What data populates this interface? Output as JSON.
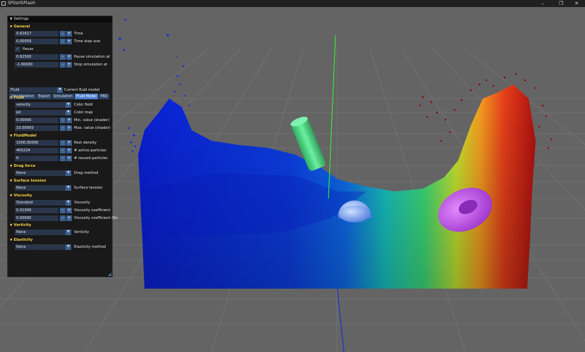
{
  "window": {
    "title": "SPlisHSPlasH",
    "minimize_glyph": "–",
    "maximize_glyph": "❐",
    "close_glyph": "✕"
  },
  "panel": {
    "title": "Settings",
    "collapse_glyph": "▼",
    "general": {
      "header": "General",
      "time": {
        "value": "0.62617",
        "label": "Time"
      },
      "time_step": {
        "value": "0.00059",
        "label": "Time step size"
      },
      "pause": {
        "label": "Pause",
        "checked": true,
        "check_glyph": "✓"
      },
      "pause_at": {
        "value": "0.62500",
        "label": "Pause simulation at"
      },
      "stop_at": {
        "value": "-1.00000",
        "label": "Stop simulation at"
      }
    },
    "tabs": [
      "Visualization",
      "Export",
      "Simulation",
      "Fluid Model",
      "PBD"
    ],
    "active_tab": "Fluid Model",
    "current_fluid": {
      "value": "Fluid",
      "label": "Current fluid model"
    },
    "fluid": {
      "header": "Fluid",
      "color_field": {
        "value": "velocity",
        "label": "Color field"
      },
      "color_map": {
        "value": "Jet",
        "label": "Color map"
      },
      "min_value": {
        "value": "0.00000",
        "label": "Min. value (shader)"
      },
      "max_value": {
        "value": "10.00000",
        "label": "Max. value (shader)"
      }
    },
    "fluid_model": {
      "header": "FluidModel",
      "rest_density": {
        "value": "1000.00000",
        "label": "Rest density"
      },
      "active_particles": {
        "value": "405224",
        "label": "# active particles"
      },
      "reused_particles": {
        "value": "0",
        "label": "# reused particles"
      }
    },
    "drag": {
      "header": "Drag force",
      "value": "None",
      "label": "Drag method"
    },
    "surface_tension": {
      "header": "Surface tension",
      "value": "None",
      "label": "Surface tension"
    },
    "viscosity": {
      "header": "Viscosity",
      "method": {
        "value": "Standard",
        "label": "Viscosity"
      },
      "coefficient": {
        "value": "0.01000",
        "label": "Viscosity coefficient"
      },
      "coefficient_bc": {
        "value": "0.00000",
        "label": "Viscosity coefficient (Bo"
      }
    },
    "vorticity": {
      "header": "Vorticity",
      "value": "None",
      "label": "Vorticity"
    },
    "elasticity": {
      "header": "Elasticity",
      "value": "None",
      "label": "Elasticity method"
    },
    "dropdown_glyph": "▼",
    "minus_glyph": "-",
    "plus_glyph": "+"
  },
  "scene": {
    "background": "#646464",
    "grid_color": "#7c7c7c",
    "fluid_colormap": "jet",
    "velocity_colors": [
      "#0a1fd6",
      "#0e6cf0",
      "#18c6c4",
      "#3ee07a",
      "#c8e830",
      "#f6a020",
      "#e8401a",
      "#8a0a0a"
    ],
    "cylinder_color": "#4fd884",
    "torus_color": "#c24fe8",
    "sphere_color": "#7da8ff",
    "axis_y_color": "#30ff30",
    "axis_z_color": "#2030d0"
  }
}
